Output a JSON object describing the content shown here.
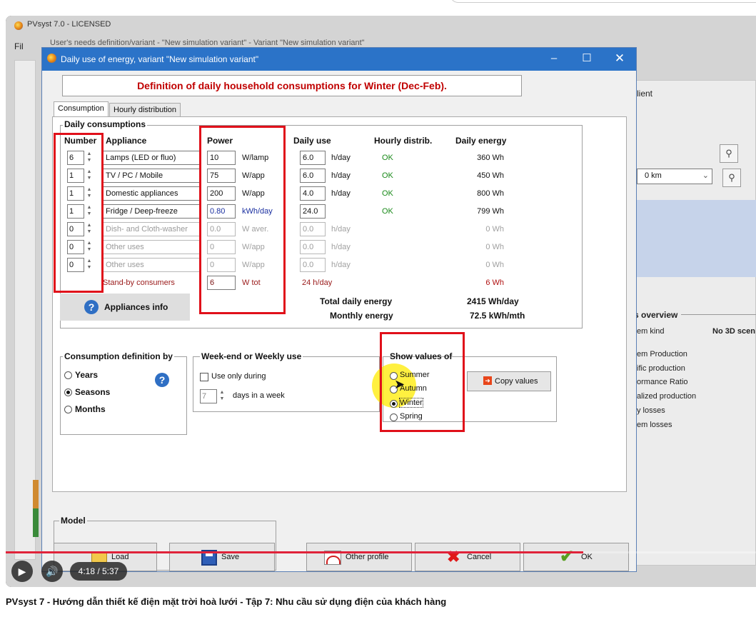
{
  "app": {
    "title": "PVsyst 7.0 - LICENSED",
    "menu_initial": "Fil",
    "behind_title": "User's needs definition/variant - \"New simulation variant\" - Variant \"New simulation variant\""
  },
  "behind": {
    "client_label": "lient",
    "distance": "0 km",
    "overview_title": "s overview",
    "system_kind": "em kind",
    "no3d": "No 3D scen",
    "lines": [
      "em Production",
      "ific production",
      "ormance Ratio",
      "alized production",
      "y losses",
      "em losses"
    ]
  },
  "dialog": {
    "title": "Daily use of energy, variant \"New simulation variant\"",
    "header": "Definition of daily household consumptions for Winter (Dec-Feb).",
    "tabs": [
      "Consumption",
      "Hourly distribution"
    ],
    "group_title": "Daily consumptions",
    "columns": {
      "number": "Number",
      "appliance": "Appliance",
      "power": "Power",
      "daily_use": "Daily use",
      "hourly": "Hourly distrib.",
      "energy": "Daily energy"
    },
    "rows": [
      {
        "number": "6",
        "appliance": "Lamps (LED or fluo)",
        "power": "10",
        "power_unit": "W/lamp",
        "daily_use": "6.0",
        "use_unit": "h/day",
        "hourly": "OK",
        "energy": "360  Wh"
      },
      {
        "number": "1",
        "appliance": "TV / PC / Mobile",
        "power": "75",
        "power_unit": "W/app",
        "daily_use": "6.0",
        "use_unit": "h/day",
        "hourly": "OK",
        "energy": "450  Wh"
      },
      {
        "number": "1",
        "appliance": "Domestic appliances",
        "power": "200",
        "power_unit": "W/app",
        "daily_use": "4.0",
        "use_unit": "h/day",
        "hourly": "OK",
        "energy": "800  Wh"
      },
      {
        "number": "1",
        "appliance": "Fridge / Deep-freeze",
        "power": "0.80",
        "power_unit": "kWh/day",
        "daily_use": "24.0",
        "use_unit": "",
        "hourly": "OK",
        "energy": "799  Wh"
      },
      {
        "number": "0",
        "appliance": "Dish- and Cloth-washer",
        "power": "0.0",
        "power_unit": "W aver.",
        "daily_use": "0.0",
        "use_unit": "h/day",
        "hourly": "",
        "energy": "0  Wh"
      },
      {
        "number": "0",
        "appliance": "Other uses",
        "power": "0",
        "power_unit": "W/app",
        "daily_use": "0.0",
        "use_unit": "h/day",
        "hourly": "",
        "energy": "0  Wh"
      },
      {
        "number": "0",
        "appliance": "Other uses",
        "power": "0",
        "power_unit": "W/app",
        "daily_use": "0.0",
        "use_unit": "h/day",
        "hourly": "",
        "energy": "0  Wh"
      }
    ],
    "standby": {
      "label": "Stand-by consumers",
      "power": "6",
      "power_unit": "W tot",
      "daily_use": "24 h/day",
      "energy": "6  Wh"
    },
    "appliances_info": "Appliances info",
    "total_label": "Total daily energy",
    "total_value": "2415  Wh/day",
    "monthly_label": "Monthly energy",
    "monthly_value": "72.5  kWh/mth",
    "consumption_def": {
      "title": "Consumption definition by",
      "options": [
        "Years",
        "Seasons",
        "Months"
      ],
      "selected": "Seasons"
    },
    "weekend": {
      "title": "Week-end or Weekly use",
      "checkbox": "Use only during",
      "days": "7",
      "days_label": "days in a week"
    },
    "show_values": {
      "title": "Show values of",
      "options": [
        "Summer",
        "Autumn",
        "Winter",
        "Spring"
      ],
      "selected": "Winter"
    },
    "copy_values": "Copy values",
    "model_title": "Model",
    "buttons": {
      "load": "Load",
      "save": "Save",
      "other_profile": "Other profile",
      "cancel": "Cancel",
      "ok": "OK"
    }
  },
  "player": {
    "time": "4:18 / 5:37",
    "progress": 0.77
  },
  "caption": "PVsyst 7 - Hướng dẫn thiết kế điện mặt trời hoà lưới - Tập 7: Nhu cầu sử dụng điện của khách hàng"
}
